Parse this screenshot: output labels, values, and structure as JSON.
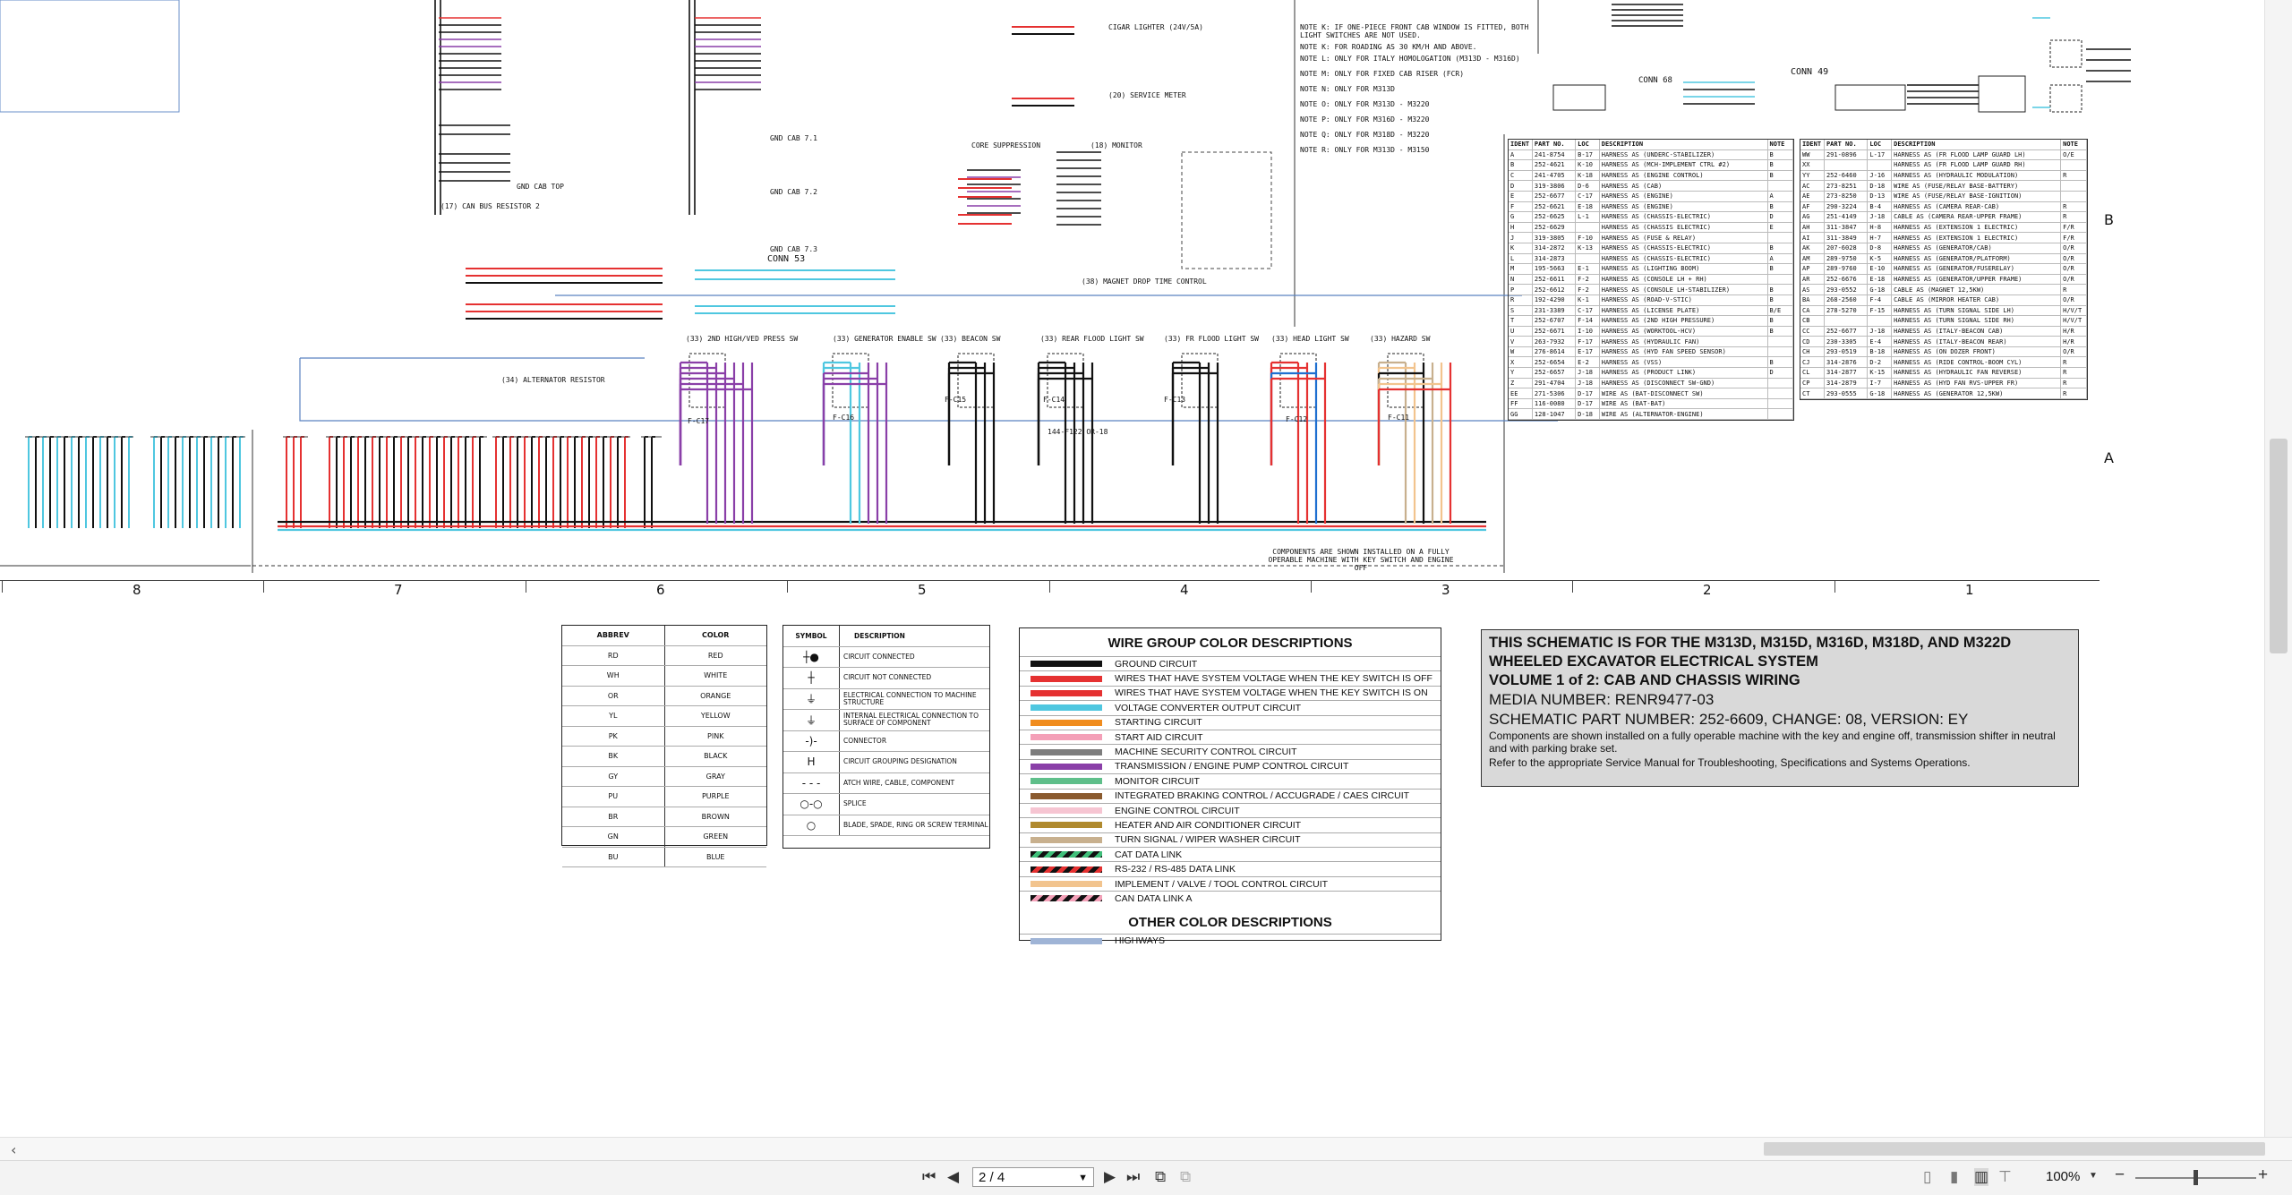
{
  "viewer": {
    "page_indicator": "2 / 4",
    "zoom": "100%",
    "scroll_left_arrow": "‹",
    "zoom_minus": "−",
    "zoom_plus": "+"
  },
  "ruler": {
    "columns": [
      "8",
      "7",
      "6",
      "5",
      "4",
      "3",
      "2",
      "1"
    ],
    "rows": [
      "B",
      "A"
    ]
  },
  "schematic_labels": {
    "switches": [
      "(33) 2ND HIGH/VED PRESS SW",
      "(33) GENERATOR ENABLE SW",
      "(33) BEACON SW",
      "(33) REAR FLOOD LIGHT SW",
      "(33) FR FLOOD LIGHT SW",
      "(33) HEAD LIGHT SW",
      "(33) HAZARD SW"
    ],
    "fuses": [
      "F-C17",
      "F-C16",
      "F-C15",
      "F-C14",
      "F-C13",
      "F-C12",
      "F-C11"
    ],
    "misc": [
      "CONN 53",
      "CONN 68",
      "CONN 49",
      "CORE SUPPRESSION",
      "(18) MONITOR",
      "(34) ALTERNATOR RESISTOR",
      "(17) CAN BUS RESISTOR 2",
      "GND CAB TOP",
      "GND CAB 7.1",
      "GND CAB 7.2",
      "GND CAB 7.3",
      "CIGAR LIGHTER (24V/5A)",
      "(20) SERVICE METER",
      "(38) MAGNET DROP TIME CONTROL",
      "144-F122 OR-18"
    ],
    "footnote": "COMPONENTS ARE SHOWN INSTALLED ON A FULLY OPERABLE MACHINE WITH KEY SWITCH AND ENGINE OFF",
    "notes": [
      "NOTE K: IF ONE-PIECE FRONT CAB WINDOW IS FITTED, BOTH LIGHT SWITCHES ARE NOT USED.",
      "NOTE K: FOR ROADING AS 30 KM/H AND ABOVE.",
      "NOTE L: ONLY FOR ITALY HOMOLOGATION (M313D - M316D)",
      "NOTE M: ONLY FOR FIXED CAB RISER (FCR)",
      "NOTE N: ONLY FOR M313D",
      "NOTE O: ONLY FOR M313D - M3220",
      "NOTE P: ONLY FOR M316D - M3220",
      "NOTE Q: ONLY FOR M318D - M3220",
      "NOTE R: ONLY FOR M313D - M3150"
    ]
  },
  "abbrev_table": {
    "headers": [
      "ABBREV",
      "COLOR"
    ],
    "rows": [
      [
        "RD",
        "RED"
      ],
      [
        "WH",
        "WHITE"
      ],
      [
        "OR",
        "ORANGE"
      ],
      [
        "YL",
        "YELLOW"
      ],
      [
        "PK",
        "PINK"
      ],
      [
        "BK",
        "BLACK"
      ],
      [
        "GY",
        "GRAY"
      ],
      [
        "PU",
        "PURPLE"
      ],
      [
        "BR",
        "BROWN"
      ],
      [
        "GN",
        "GREEN"
      ],
      [
        "BU",
        "BLUE"
      ]
    ]
  },
  "symbol_table": {
    "headers": [
      "SYMBOL",
      "DESCRIPTION"
    ],
    "rows": [
      {
        "sym": "┼●",
        "desc": "CIRCUIT CONNECTED"
      },
      {
        "sym": "┼",
        "desc": "CIRCUIT NOT CONNECTED"
      },
      {
        "sym": "⏚",
        "desc": "ELECTRICAL CONNECTION TO MACHINE STRUCTURE"
      },
      {
        "sym": "⏚",
        "desc": "INTERNAL ELECTRICAL CONNECTION TO SURFACE OF COMPONENT"
      },
      {
        "sym": "-)-",
        "desc": "CONNECTOR"
      },
      {
        "sym": "H",
        "desc": "CIRCUIT GROUPING DESIGNATION"
      },
      {
        "sym": "- - -",
        "desc": "ATCH WIRE, CABLE, COMPONENT"
      },
      {
        "sym": "○-○",
        "desc": "SPLICE"
      },
      {
        "sym": "○",
        "desc": "BLADE, SPADE, RING OR SCREW TERMINAL"
      }
    ]
  },
  "wire_group": {
    "title": "WIRE GROUP COLOR DESCRIPTIONS",
    "rows": [
      {
        "label": "GROUND CIRCUIT",
        "color": "#111111",
        "striped": false
      },
      {
        "label": "WIRES THAT HAVE SYSTEM VOLTAGE WHEN THE KEY SWITCH IS OFF",
        "color": "#e53131",
        "striped": false
      },
      {
        "label": "WIRES THAT HAVE SYSTEM VOLTAGE WHEN THE KEY SWITCH IS ON",
        "color": "#e53131",
        "striped": false
      },
      {
        "label": "VOLTAGE CONVERTER OUTPUT CIRCUIT",
        "color": "#4fc7e0",
        "striped": false
      },
      {
        "label": "STARTING CIRCUIT",
        "color": "#f08c1e",
        "striped": false
      },
      {
        "label": "START AID CIRCUIT",
        "color": "#f4a0b8",
        "striped": false
      },
      {
        "label": "MACHINE SECURITY CONTROL CIRCUIT",
        "color": "#7d7d7d",
        "striped": false
      },
      {
        "label": "TRANSMISSION / ENGINE PUMP CONTROL CIRCUIT",
        "color": "#8a3fa8",
        "striped": false
      },
      {
        "label": "MONITOR CIRCUIT",
        "color": "#5fbf8a",
        "striped": false
      },
      {
        "label": "INTEGRATED BRAKING CONTROL / ACCUGRADE / CAES CIRCUIT",
        "color": "#8a5a2e",
        "striped": false
      },
      {
        "label": "ENGINE CONTROL CIRCUIT",
        "color": "#f6c5d2",
        "striped": false
      },
      {
        "label": "HEATER AND AIR CONDITIONER CIRCUIT",
        "color": "#b08a2e",
        "striped": false
      },
      {
        "label": "TURN SIGNAL / WIPER WASHER CIRCUIT",
        "color": "#c8b08e",
        "striped": false
      },
      {
        "label": "CAT DATA LINK",
        "color": "#3fbf7a",
        "striped": true
      },
      {
        "label": "RS-232 / RS-485 DATA LINK",
        "color": "#e53131",
        "striped": true
      },
      {
        "label": "IMPLEMENT / VALVE / TOOL CONTROL CIRCUIT",
        "color": "#f2c48e",
        "striped": false
      },
      {
        "label": "CAN DATA LINK A",
        "color": "#f4a0b8",
        "striped": true
      }
    ],
    "other_title": "OTHER COLOR DESCRIPTIONS",
    "other_rows": [
      {
        "label": "HIGHWAYS",
        "color": "#9fb4d6"
      }
    ]
  },
  "title_block": {
    "line1": "THIS SCHEMATIC IS FOR THE M313D, M315D, M316D, M318D, AND M322D",
    "line2": "WHEELED EXCAVATOR ELECTRICAL SYSTEM",
    "line3": "VOLUME 1 of 2: CAB AND CHASSIS WIRING",
    "media": "MEDIA NUMBER: RENR9477-03",
    "part": "SCHEMATIC PART NUMBER: 252-6609, CHANGE: 08, VERSION: EY",
    "note1": "Components are shown installed on a fully operable machine with the key and engine off, transmission shifter in neutral and with parking brake set.",
    "note2": "Refer to the appropriate Service Manual for Troubleshooting, Specifications and Systems Operations."
  },
  "parts_left": {
    "headers": [
      "IDENT",
      "PART NO.",
      "LOC",
      "DESCRIPTION",
      "NOTE"
    ],
    "rows": [
      [
        "A",
        "241-8754",
        "B-17",
        "HARNESS AS (UNDERC-STABILIZER)",
        "B"
      ],
      [
        "B",
        "252-4621",
        "K-10",
        "HARNESS AS (MCH-IMPLEMENT CTRL #2)",
        "B"
      ],
      [
        "C",
        "241-4705",
        "K-18",
        "HARNESS AS (ENGINE CONTROL)",
        "B"
      ],
      [
        "D",
        "319-3806",
        "D-6",
        "HARNESS AS (CAB)",
        ""
      ],
      [
        "E",
        "252-6677",
        "C-17",
        "HARNESS AS (ENGINE)",
        "A"
      ],
      [
        "F",
        "252-6621",
        "E-18",
        "HARNESS AS (ENGINE)",
        "B"
      ],
      [
        "G",
        "252-6625",
        "L-1",
        "HARNESS AS (CHASSIS-ELECTRIC)",
        "D"
      ],
      [
        "H",
        "252-6629",
        "",
        "HARNESS AS (CHASSIS ELECTRIC)",
        "E"
      ],
      [
        "J",
        "319-3805",
        "F-10",
        "HARNESS AS (FUSE & RELAY)",
        ""
      ],
      [
        "K",
        "314-2872",
        "K-13",
        "HARNESS AS (CHASSIS-ELECTRIC)",
        "B"
      ],
      [
        "L",
        "314-2873",
        "",
        "HARNESS AS (CHASSIS-ELECTRIC)",
        "A"
      ],
      [
        "M",
        "195-5663",
        "E-1",
        "HARNESS AS (LIGHTING BOOM)",
        "B"
      ],
      [
        "N",
        "252-6611",
        "F-2",
        "HARNESS AS (CONSOLE LH + RH)",
        ""
      ],
      [
        "P",
        "252-6612",
        "F-2",
        "HARNESS AS (CONSOLE LH-STABILIZER)",
        "B"
      ],
      [
        "R",
        "192-4290",
        "K-1",
        "HARNESS AS (ROAD-V-STIC)",
        "B"
      ],
      [
        "S",
        "231-3389",
        "C-17",
        "HARNESS AS (LICENSE PLATE)",
        "B/E"
      ],
      [
        "T",
        "252-6707",
        "F-14",
        "HARNESS AS (2ND HIGH PRESSURE)",
        "B"
      ],
      [
        "U",
        "252-6671",
        "I-10",
        "HARNESS AS (WORKTOOL-HCV)",
        "B"
      ],
      [
        "V",
        "263-7932",
        "F-17",
        "HARNESS AS (HYDRAULIC FAN)",
        ""
      ],
      [
        "W",
        "276-8614",
        "E-17",
        "HARNESS AS (HYD FAN SPEED SENSOR)",
        ""
      ],
      [
        "X",
        "252-6654",
        "E-2",
        "HARNESS AS (VSS)",
        "B"
      ],
      [
        "Y",
        "252-6657",
        "J-18",
        "HARNESS AS (PRODUCT LINK)",
        "D"
      ],
      [
        "Z",
        "291-4704",
        "J-18",
        "HARNESS AS (DISCONNECT SW-GND)",
        ""
      ],
      [
        "EE",
        "271-5306",
        "D-17",
        "WIRE AS (BAT-DISCONNECT SW)",
        ""
      ],
      [
        "FF",
        "116-0080",
        "D-17",
        "WIRE AS (BAT-BAT)",
        ""
      ],
      [
        "GG",
        "128-1047",
        "D-18",
        "WIRE AS (ALTERNATOR-ENGINE)",
        ""
      ]
    ]
  },
  "parts_right": {
    "headers": [
      "IDENT",
      "PART NO.",
      "LOC",
      "DESCRIPTION",
      "NOTE"
    ],
    "rows": [
      [
        "WW",
        "291-0896",
        "L-17",
        "HARNESS AS (FR FLOOD LAMP GUARD LH)",
        "O/E"
      ],
      [
        "XX",
        "",
        "",
        "HARNESS AS (FR FLOOD LAMP GUARD RH)",
        ""
      ],
      [
        "YY",
        "252-6460",
        "J-16",
        "HARNESS AS (HYDRAULIC MODULATION)",
        "R"
      ],
      [
        "AC",
        "273-8251",
        "D-18",
        "WIRE AS (FUSE/RELAY BASE-BATTERY)",
        ""
      ],
      [
        "AE",
        "273-8250",
        "D-13",
        "WIRE AS (FUSE/RELAY BASE-IGNITION)",
        ""
      ],
      [
        "AF",
        "290-3224",
        "B-4",
        "HARNESS AS (CAMERA REAR-CAB)",
        "R"
      ],
      [
        "AG",
        "251-4149",
        "J-18",
        "CABLE AS (CAMERA REAR-UPPER FRAME)",
        "R"
      ],
      [
        "AH",
        "311-3847",
        "H-8",
        "HARNESS AS (EXTENSION 1 ELECTRIC)",
        "F/R"
      ],
      [
        "AI",
        "311-3849",
        "H-7",
        "HARNESS AS (EXTENSION 1 ELECTRIC)",
        "F/R"
      ],
      [
        "AK",
        "207-6028",
        "D-8",
        "HARNESS AS (GENERATOR/CAB)",
        "O/R"
      ],
      [
        "AM",
        "289-9750",
        "K-5",
        "HARNESS AS (GENERATOR/PLATFORM)",
        "O/R"
      ],
      [
        "AP",
        "289-9760",
        "E-10",
        "HARNESS AS (GENERATOR/FUSERELAY)",
        "O/R"
      ],
      [
        "AR",
        "252-6676",
        "E-18",
        "HARNESS AS (GENERATOR/UPPER FRAME)",
        "O/R"
      ],
      [
        "AS",
        "293-0552",
        "G-18",
        "CABLE AS (MAGNET 12,5KW)",
        "R"
      ],
      [
        "BA",
        "268-2560",
        "F-4",
        "CABLE AS (MIRROR HEATER CAB)",
        "O/R"
      ],
      [
        "CA",
        "278-5270",
        "F-15",
        "HARNESS AS (TURN SIGNAL SIDE LH)",
        "H/V/T"
      ],
      [
        "CB",
        "",
        "",
        "HARNESS AS (TURN SIGNAL SIDE RH)",
        "H/V/T"
      ],
      [
        "CC",
        "252-6677",
        "J-18",
        "HARNESS AS (ITALY-BEACON CAB)",
        "H/R"
      ],
      [
        "CD",
        "230-3305",
        "E-4",
        "HARNESS AS (ITALY-BEACON REAR)",
        "H/R"
      ],
      [
        "CH",
        "293-0519",
        "B-18",
        "HARNESS AS (ON DOZER FRONT)",
        "O/R"
      ],
      [
        "CJ",
        "314-2876",
        "D-2",
        "HARNESS AS (RIDE CONTROL-BOOM CYL)",
        "R"
      ],
      [
        "CL",
        "314-2877",
        "K-15",
        "HARNESS AS (HYDRAULIC FAN REVERSE)",
        "R"
      ],
      [
        "CP",
        "314-2879",
        "I-7",
        "HARNESS AS (HYD FAN RVS-UPPER FR)",
        "R"
      ],
      [
        "CT",
        "293-0555",
        "G-18",
        "HARNESS AS (GENERATOR 12,5KW)",
        "R"
      ]
    ]
  }
}
